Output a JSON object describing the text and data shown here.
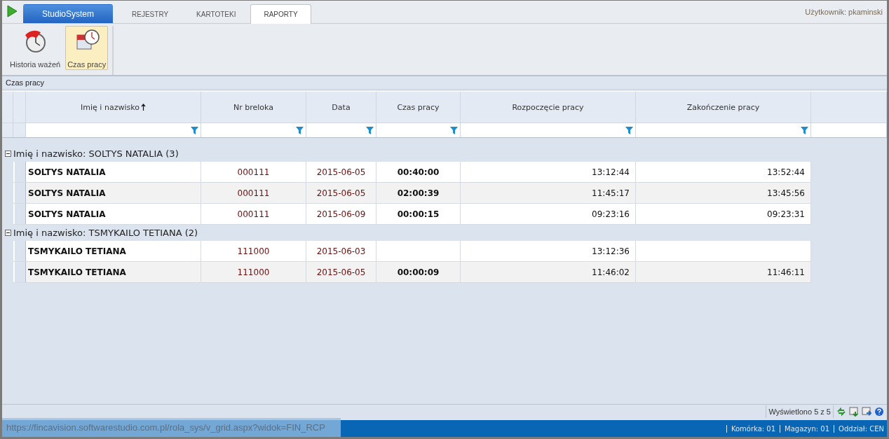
{
  "tabs": [
    {
      "label": "StudioSystem",
      "kind": "app",
      "selected": false
    },
    {
      "label": "REJESTRY",
      "kind": "tab",
      "selected": false
    },
    {
      "label": "KARTOTEKI",
      "kind": "tab",
      "selected": false
    },
    {
      "label": "RAPORTY",
      "kind": "tab",
      "selected": true
    }
  ],
  "user": "Użytkownik: pkaminski",
  "ribbon": [
    {
      "label": "Historia ważeń",
      "selected": false
    },
    {
      "label": "Czas pracy",
      "selected": true
    }
  ],
  "panel_title": "Czas pracy",
  "table": {
    "columns": [
      {
        "label": "Imię i nazwisko",
        "sorted": true
      },
      {
        "label": "Nr breloka",
        "sorted": false
      },
      {
        "label": "Data",
        "sorted": false
      },
      {
        "label": "Czas pracy",
        "sorted": false
      },
      {
        "label": "Rozpoczęcie pracy",
        "sorted": false
      },
      {
        "label": "Zakończenie pracy",
        "sorted": false
      }
    ],
    "groups": [
      {
        "label": "Imię i nazwisko: SOLTYS NATALIA (3)",
        "expanded": true,
        "rows": [
          [
            "SOLTYS NATALIA",
            "000111",
            "2015-06-05",
            "00:40:00",
            "13:12:44",
            "13:52:44"
          ],
          [
            "SOLTYS NATALIA",
            "000111",
            "2015-06-05",
            "02:00:39",
            "11:45:17",
            "13:45:56"
          ],
          [
            "SOLTYS NATALIA",
            "000111",
            "2015-06-09",
            "00:00:15",
            "09:23:16",
            "09:23:31"
          ]
        ]
      },
      {
        "label": "Imię i nazwisko: TSMYKAILO TETIANA (2)",
        "expanded": true,
        "rows": [
          [
            "TSMYKAILO TETIANA",
            "111000",
            "2015-06-03",
            "",
            "13:12:36",
            ""
          ],
          [
            "TSMYKAILO TETIANA",
            "111000",
            "2015-06-05",
            "00:00:09",
            "11:46:02",
            "11:46:11"
          ]
        ]
      }
    ]
  },
  "pager": "Wyświetlono 5 z 5",
  "status_bar": {
    "items": [
      "Komórka: 01",
      "Magazyn: 01",
      "Oddział: CEN"
    ]
  },
  "url_tooltip": "https://fincavision.softwarestudio.com.pl/rola_sys/v_grid.aspx?widok=FIN_RCP"
}
